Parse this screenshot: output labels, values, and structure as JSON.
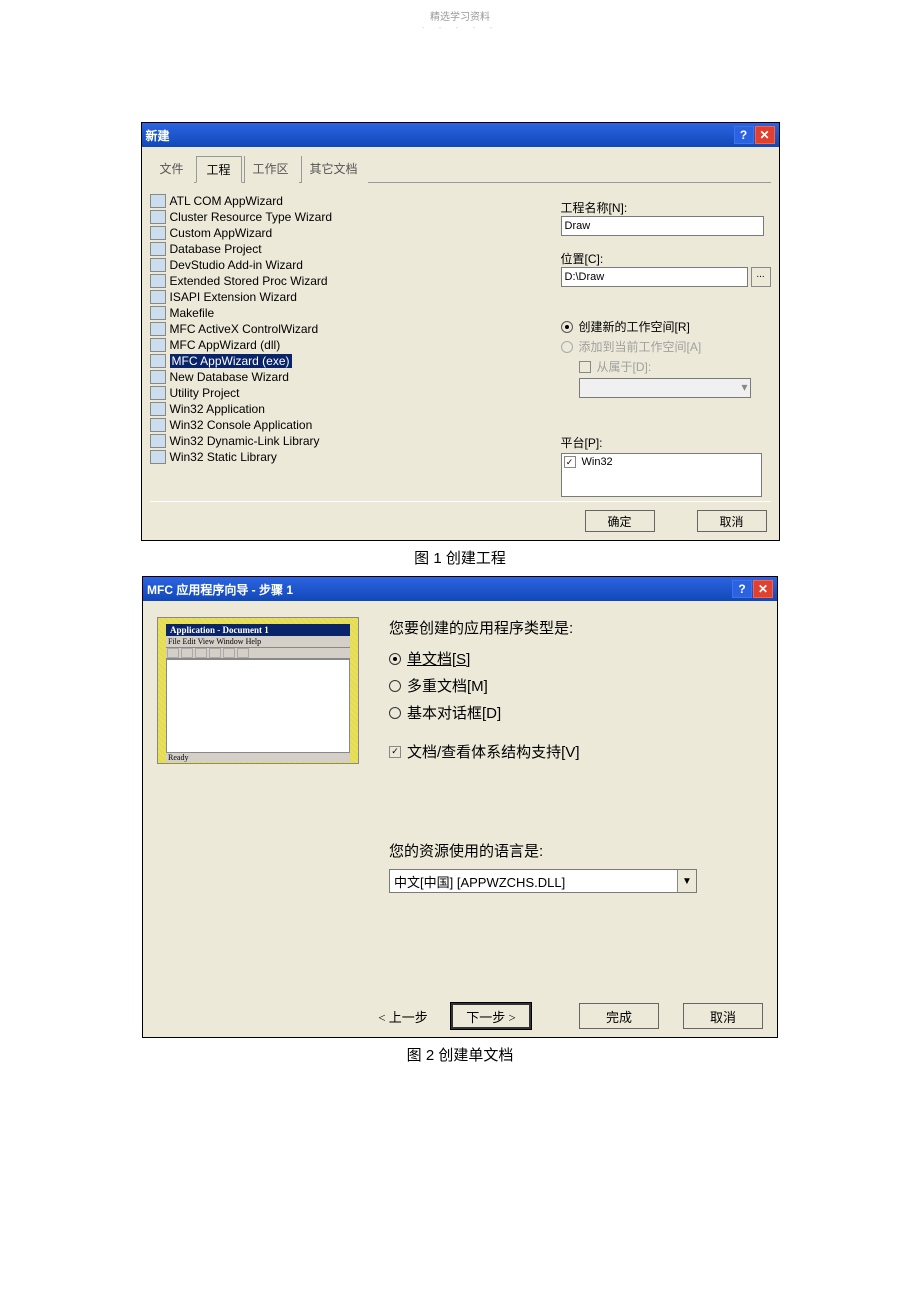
{
  "header": {
    "title": "精选学习资料",
    "sub": "- - - - -"
  },
  "dialog1": {
    "title": "新建",
    "tabs": [
      "文件",
      "工程",
      "工作区",
      "其它文档"
    ],
    "projects": [
      "ATL COM AppWizard",
      "Cluster Resource Type Wizard",
      "Custom AppWizard",
      "Database Project",
      "DevStudio Add-in Wizard",
      "Extended Stored Proc Wizard",
      "ISAPI Extension Wizard",
      "Makefile",
      "MFC ActiveX ControlWizard",
      "MFC AppWizard (dll)",
      "MFC AppWizard (exe)",
      "New Database Wizard",
      "Utility Project",
      "Win32 Application",
      "Win32 Console Application",
      "Win32 Dynamic-Link Library",
      "Win32 Static Library"
    ],
    "name_label": "工程名称[N]:",
    "name_value": "Draw",
    "loc_label": "位置[C]:",
    "loc_value": "D:\\Draw",
    "ws_new": "创建新的工作空间[R]",
    "ws_add": "添加到当前工作空间[A]",
    "ws_dep": "从属于[D]:",
    "plat_label": "平台[P]:",
    "plat_value": "Win32",
    "ok": "确定",
    "cancel": "取消"
  },
  "caption1": "图 1  创建工程",
  "dialog2": {
    "title": "MFC 应用程序向导 - 步骤 1",
    "preview": {
      "title": "Application - Document 1",
      "menu": "File Edit View Window Help",
      "status": "Ready"
    },
    "q1": "您要创建的应用程序类型是:",
    "opt_single": "单文档[S]",
    "opt_multi": "多重文档[M]",
    "opt_dialog": "基本对话框[D]",
    "chk_docview": "文档/查看体系结构支持[V]",
    "q2": "您的资源使用的语言是:",
    "lang_value": "中文[中国] [APPWZCHS.DLL]",
    "back": "< 上一步",
    "next": "下一步 >",
    "finish": "完成",
    "cancel": "取消"
  },
  "caption2": "图 2  创建单文档"
}
